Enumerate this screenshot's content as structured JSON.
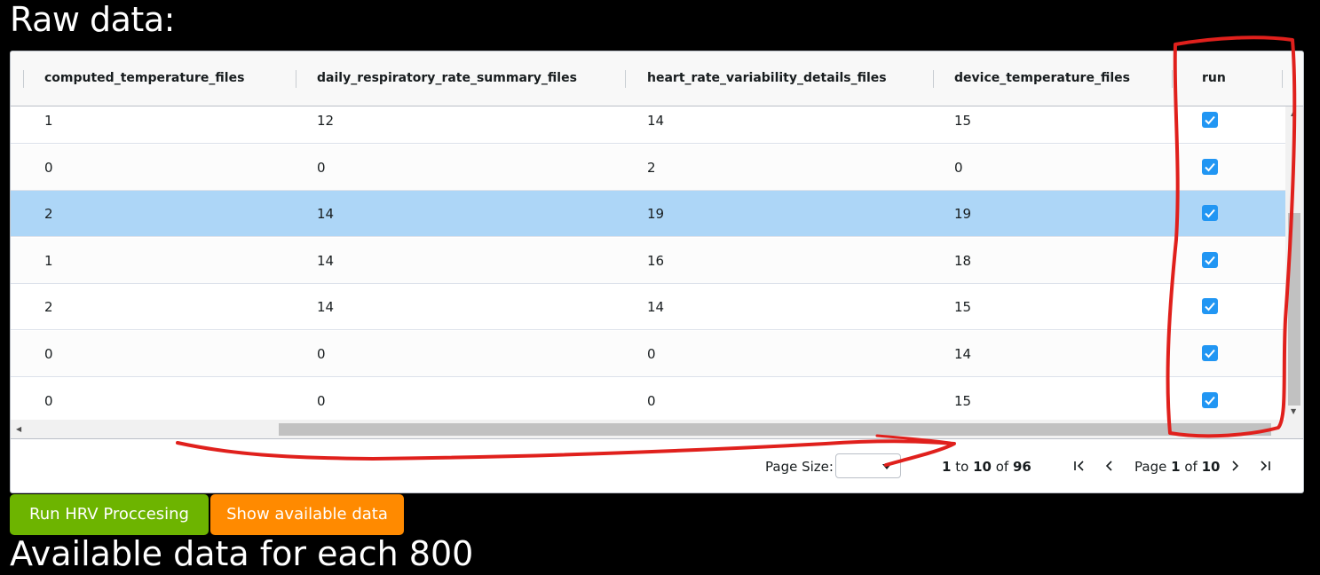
{
  "page": {
    "title": "Raw data:",
    "next_heading": "Available data for each 800"
  },
  "grid": {
    "columns": [
      "computed_temperature_files",
      "daily_respiratory_rate_summary_files",
      "heart_rate_variability_details_files",
      "device_temperature_files",
      "run"
    ],
    "rows": [
      {
        "c1": "1",
        "c2": "12",
        "c3": "14",
        "c4": "15",
        "run": true,
        "selected": false
      },
      {
        "c1": "0",
        "c2": "0",
        "c3": "2",
        "c4": "0",
        "run": true,
        "selected": false
      },
      {
        "c1": "2",
        "c2": "14",
        "c3": "19",
        "c4": "19",
        "run": true,
        "selected": true
      },
      {
        "c1": "1",
        "c2": "14",
        "c3": "16",
        "c4": "18",
        "run": true,
        "selected": false
      },
      {
        "c1": "2",
        "c2": "14",
        "c3": "14",
        "c4": "15",
        "run": true,
        "selected": false
      },
      {
        "c1": "0",
        "c2": "0",
        "c3": "0",
        "c4": "14",
        "run": true,
        "selected": false
      },
      {
        "c1": "0",
        "c2": "0",
        "c3": "0",
        "c4": "15",
        "run": true,
        "selected": false
      }
    ]
  },
  "pagination": {
    "page_size_label": "Page Size:",
    "page_size_value": "",
    "row_from": "1",
    "row_to_word": "to",
    "row_to": "10",
    "of_word": "of",
    "row_total": "96",
    "page_word": "Page",
    "current_page": "1",
    "total_pages": "10"
  },
  "buttons": {
    "run_label": "Run HRV Proccesing",
    "show_label": "Show available data"
  },
  "colors": {
    "run_button": "#6db400",
    "show_button": "#ff8a00",
    "selected_row": "#add6f7",
    "checkbox": "#2196f3",
    "annotation": "#e0201c"
  },
  "icons": {
    "checkbox": "check-icon",
    "first": "first-page-icon",
    "prev": "prev-page-icon",
    "next": "next-page-icon",
    "last": "last-page-icon"
  }
}
